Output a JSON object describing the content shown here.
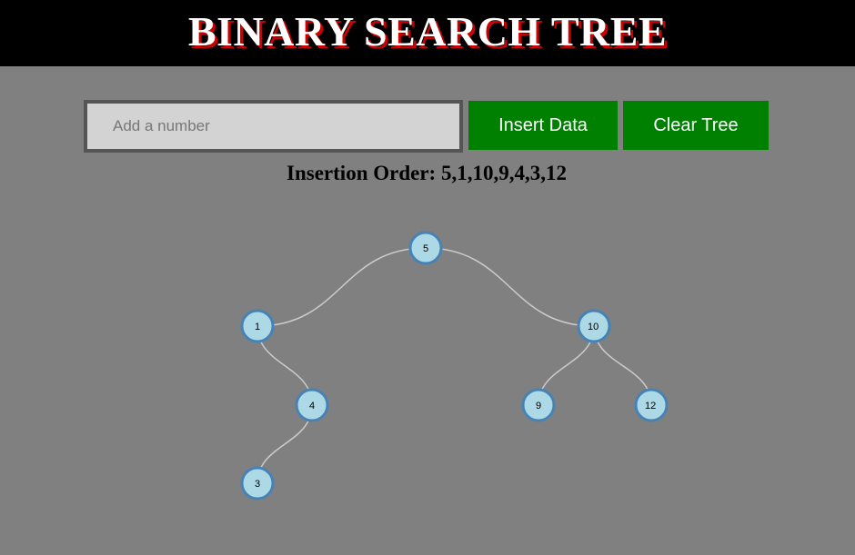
{
  "header": {
    "title": "BINARY SEARCH TREE"
  },
  "controls": {
    "input_placeholder": "Add a number",
    "input_value": "",
    "insert_label": "Insert Data",
    "clear_label": "Clear Tree"
  },
  "insertion": {
    "label": "Insertion Order: 5,1,10,9,4,3,12"
  },
  "colors": {
    "background": "#808080",
    "header_bg": "#000000",
    "title_shadow": "#cc0000",
    "button_bg": "#008000",
    "node_fill": "#add8e6",
    "node_stroke": "#4682b4",
    "link_stroke": "#cccccc"
  },
  "tree": {
    "nodes": [
      {
        "id": "5",
        "label": "5"
      },
      {
        "id": "1",
        "label": "1"
      },
      {
        "id": "10",
        "label": "10"
      },
      {
        "id": "4",
        "label": "4"
      },
      {
        "id": "3",
        "label": "3"
      },
      {
        "id": "9",
        "label": "9"
      },
      {
        "id": "12",
        "label": "12"
      }
    ],
    "links": [
      {
        "from": "5",
        "to": "1"
      },
      {
        "from": "5",
        "to": "10"
      },
      {
        "from": "1",
        "to": "4"
      },
      {
        "from": "4",
        "to": "3"
      },
      {
        "from": "10",
        "to": "9"
      },
      {
        "from": "10",
        "to": "12"
      }
    ]
  }
}
